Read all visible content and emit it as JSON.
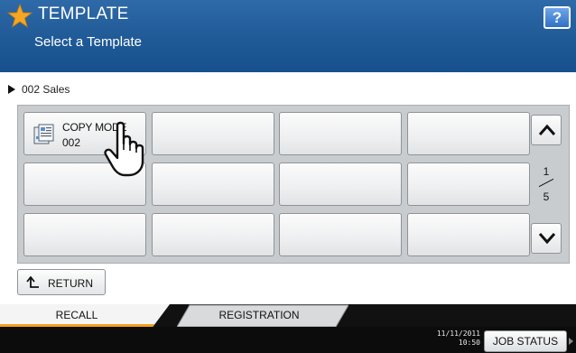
{
  "header": {
    "title": "TEMPLATE",
    "subtitle": "Select a Template",
    "help_label": "?",
    "star_color": "#f5a623",
    "bg_color": "#1f5a97"
  },
  "breadcrumb": {
    "label": "002 Sales"
  },
  "templates": [
    {
      "name": "COPY MODE",
      "number": "002",
      "icon": "copy-mode-icon"
    },
    {},
    {},
    {},
    {},
    {},
    {},
    {},
    {},
    {},
    {},
    {}
  ],
  "pagination": {
    "current": "1",
    "total": "5"
  },
  "return_button": {
    "label": "RETURN"
  },
  "tabs": [
    {
      "label": "RECALL",
      "active": true
    },
    {
      "label": "REGISTRATION",
      "active": false
    }
  ],
  "status": {
    "date": "11/11/2011",
    "time": "10:50",
    "job_status_label": "JOB STATUS"
  },
  "accent_color": "#f0a020"
}
